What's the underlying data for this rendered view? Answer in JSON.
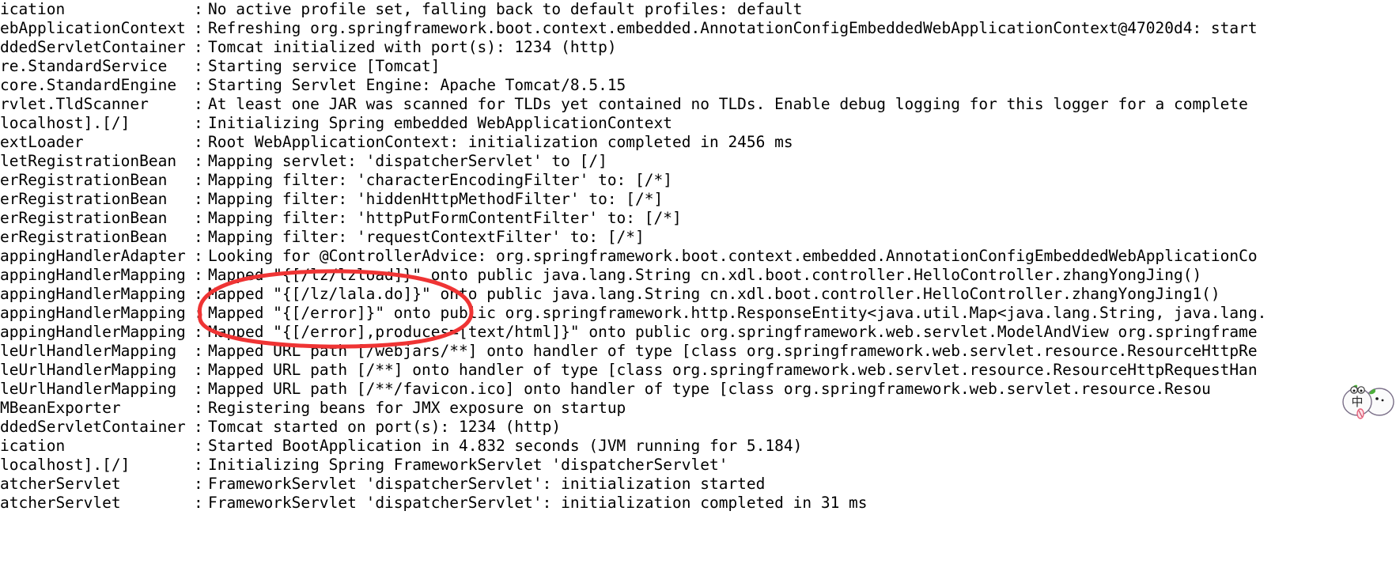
{
  "console": {
    "background_color": "#ffffff",
    "text_color": "#000000",
    "description": "Spring Boot application startup console log, horizontally scrolled so logger names are clipped at the left edge and long messages are clipped at the right edge",
    "lines": [
      {
        "logger": "ication",
        "sep": ":",
        "message": "No active profile set, falling back to default profiles: default"
      },
      {
        "logger": "ebApplicationContext",
        "sep": ":",
        "message": "Refreshing org.springframework.boot.context.embedded.AnnotationConfigEmbeddedWebApplicationContext@47020d4: start"
      },
      {
        "logger": "ddedServletContainer",
        "sep": ":",
        "message": "Tomcat initialized with port(s): 1234 (http)"
      },
      {
        "logger": "re.StandardService",
        "sep": ":",
        "message": "Starting service [Tomcat]"
      },
      {
        "logger": "core.StandardEngine",
        "sep": ":",
        "message": "Starting Servlet Engine: Apache Tomcat/8.5.15"
      },
      {
        "logger": "rvlet.TldScanner",
        "sep": ":",
        "message": "At least one JAR was scanned for TLDs yet contained no TLDs. Enable debug logging for this logger for a complete"
      },
      {
        "logger": "localhost].[/]",
        "sep": ":",
        "message": "Initializing Spring embedded WebApplicationContext"
      },
      {
        "logger": "extLoader",
        "sep": ":",
        "message": "Root WebApplicationContext: initialization completed in 2456 ms"
      },
      {
        "logger": "letRegistrationBean",
        "sep": ":",
        "message": "Mapping servlet: 'dispatcherServlet' to [/]"
      },
      {
        "logger": "erRegistrationBean",
        "sep": ":",
        "message": "Mapping filter: 'characterEncodingFilter' to: [/*]"
      },
      {
        "logger": "erRegistrationBean",
        "sep": ":",
        "message": "Mapping filter: 'hiddenHttpMethodFilter' to: [/*]"
      },
      {
        "logger": "erRegistrationBean",
        "sep": ":",
        "message": "Mapping filter: 'httpPutFormContentFilter' to: [/*]"
      },
      {
        "logger": "erRegistrationBean",
        "sep": ":",
        "message": "Mapping filter: 'requestContextFilter' to: [/*]"
      },
      {
        "logger": "appingHandlerAdapter",
        "sep": ":",
        "message": "Looking for @ControllerAdvice: org.springframework.boot.context.embedded.AnnotationConfigEmbeddedWebApplicationCo"
      },
      {
        "logger": "appingHandlerMapping",
        "sep": ":",
        "message": "Mapped \"{[/lz/lzload]}\" onto public java.lang.String cn.xdl.boot.controller.HelloController.zhangYongJing()"
      },
      {
        "logger": "appingHandlerMapping",
        "sep": ":",
        "message": "Mapped \"{[/lz/lala.do]}\" onto public java.lang.String cn.xdl.boot.controller.HelloController.zhangYongJing1()"
      },
      {
        "logger": "appingHandlerMapping",
        "sep": ":",
        "message": "Mapped \"{[/error]}\" onto public org.springframework.http.ResponseEntity<java.util.Map<java.lang.String, java.lang."
      },
      {
        "logger": "appingHandlerMapping",
        "sep": ":",
        "message": "Mapped \"{[/error],produces=[text/html]}\" onto public org.springframework.web.servlet.ModelAndView org.springframe"
      },
      {
        "logger": "leUrlHandlerMapping",
        "sep": ":",
        "message": "Mapped URL path [/webjars/**] onto handler of type [class org.springframework.web.servlet.resource.ResourceHttpRe"
      },
      {
        "logger": "leUrlHandlerMapping",
        "sep": ":",
        "message": "Mapped URL path [/**] onto handler of type [class org.springframework.web.servlet.resource.ResourceHttpRequestHan"
      },
      {
        "logger": "leUrlHandlerMapping",
        "sep": ":",
        "message": "Mapped URL path [/**/favicon.ico] onto handler of type [class org.springframework.web.servlet.resource.Resou"
      },
      {
        "logger": "MBeanExporter",
        "sep": ":",
        "message": "Registering beans for JMX exposure on startup"
      },
      {
        "logger": "ddedServletContainer",
        "sep": ":",
        "message": "Tomcat started on port(s): 1234 (http)"
      },
      {
        "logger": "ication",
        "sep": ":",
        "message": "Started BootApplication in 4.832 seconds (JVM running for 5.184)"
      },
      {
        "logger": "localhost].[/]",
        "sep": ":",
        "message": "Initializing Spring FrameworkServlet 'dispatcherServlet'"
      },
      {
        "logger": "atcherServlet",
        "sep": ":",
        "message": "FrameworkServlet 'dispatcherServlet': initialization started"
      },
      {
        "logger": "atcherServlet",
        "sep": ":",
        "message": "FrameworkServlet 'dispatcherServlet': initialization completed in 31 ms"
      }
    ]
  },
  "annotation": {
    "type": "hand-drawn-ellipse",
    "color": "#ef3434",
    "stroke_width": 5,
    "highlights": [
      "Mapped \"{[/lz/lzload]}\"",
      "Mapped \"{[/lz/lala.do]}\""
    ]
  },
  "sticker": {
    "label": "cartoon-fruit-sticker",
    "character": "中",
    "leaf_color": "#4caf3a",
    "body_color": "#fbfbfb",
    "accent_color": "#e8607a"
  }
}
